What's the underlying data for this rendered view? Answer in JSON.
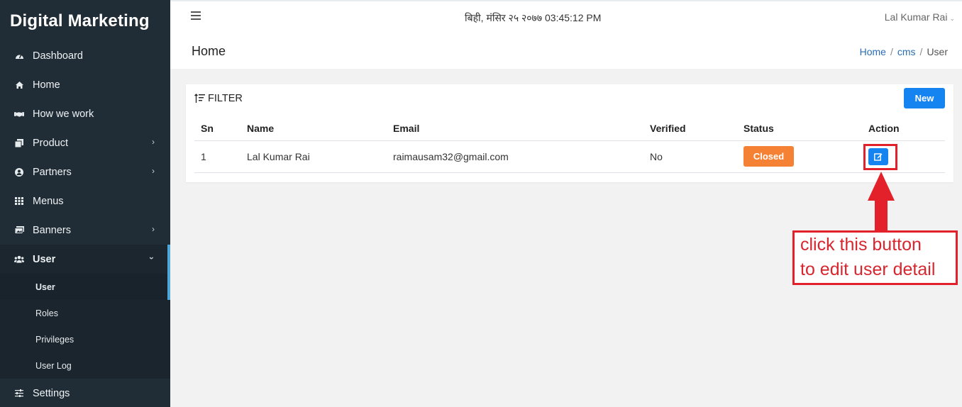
{
  "sidebar": {
    "brand": "Digital Marketing",
    "items": [
      {
        "label": "Dashboard",
        "icon": "dashboard-icon"
      },
      {
        "label": "Home",
        "icon": "home-icon"
      },
      {
        "label": "How we work",
        "icon": "handshake-icon"
      },
      {
        "label": "Product",
        "icon": "copy-icon",
        "expandable": true
      },
      {
        "label": "Partners",
        "icon": "user-circle-icon",
        "expandable": true
      },
      {
        "label": "Menus",
        "icon": "grid-icon"
      },
      {
        "label": "Banners",
        "icon": "image-icon",
        "expandable": true
      },
      {
        "label": "User",
        "icon": "users-icon",
        "expandable": true,
        "expanded": true
      },
      {
        "label": "Settings",
        "icon": "sliders-icon"
      }
    ],
    "user_subitems": [
      {
        "label": "User",
        "current": true
      },
      {
        "label": "Roles"
      },
      {
        "label": "Privileges"
      },
      {
        "label": "User Log"
      }
    ],
    "accent_color": "#4fa7d9"
  },
  "topbar": {
    "datetime": "बिही, मंसिर २५ २०७७ 03:45:12 PM",
    "user_name": "Lal Kumar Rai"
  },
  "page": {
    "title": "Home",
    "breadcrumb": [
      "Home",
      "cms",
      "User"
    ]
  },
  "card": {
    "filter_label": "FILTER",
    "new_button": "New",
    "columns": [
      "Sn",
      "Name",
      "Email",
      "Verified",
      "Status",
      "Action"
    ],
    "rows": [
      {
        "sn": "1",
        "name": "Lal Kumar Rai",
        "email": "raimausam32@gmail.com",
        "verified": "No",
        "status": "Closed"
      }
    ]
  },
  "annotation": {
    "line1": "click this button",
    "line2": "to edit user detail",
    "color": "#e3212b"
  },
  "colors": {
    "primary": "#1584f0",
    "status_closed": "#f58234",
    "sidebar_bg": "#212d36"
  }
}
